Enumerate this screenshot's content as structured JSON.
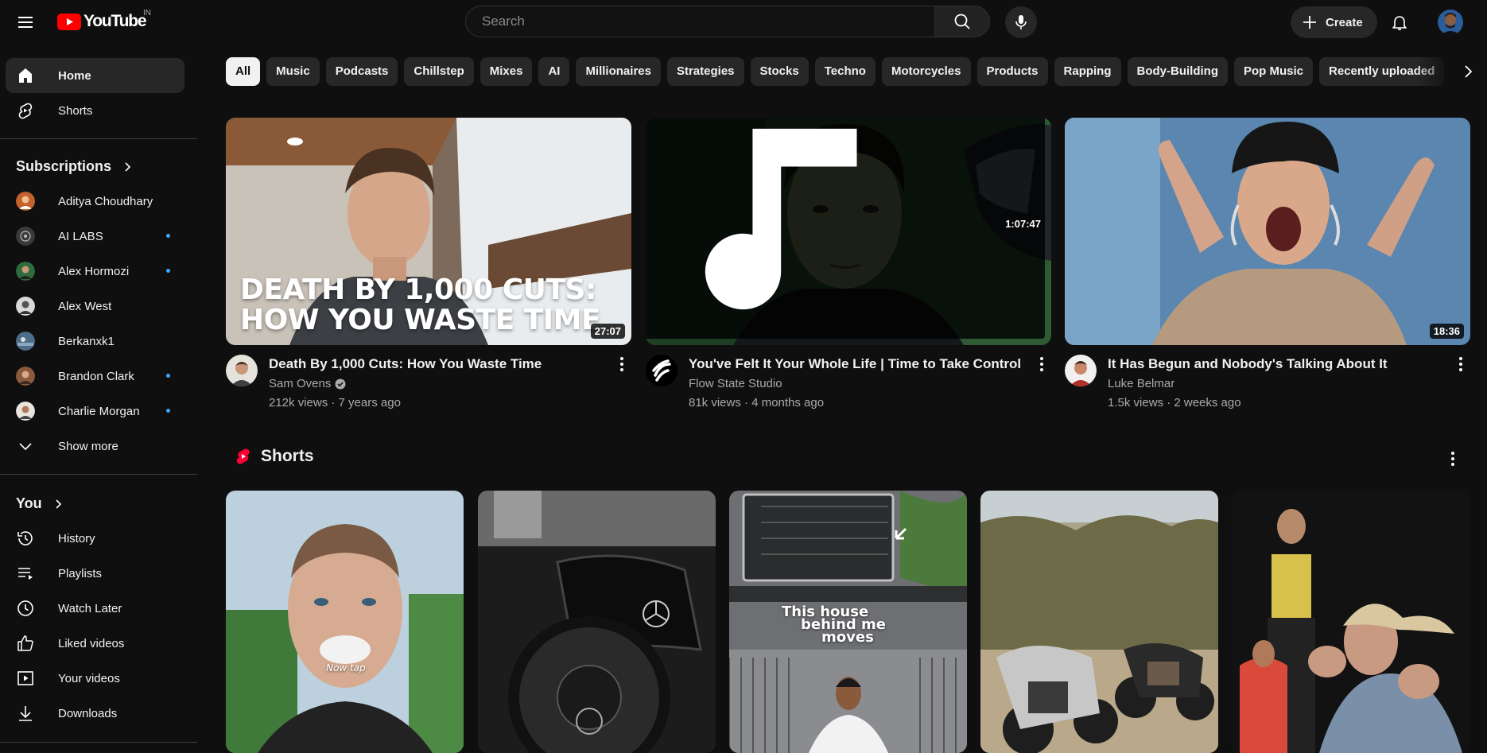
{
  "masthead": {
    "logo_text": "YouTube",
    "country_code": "IN",
    "search_placeholder": "Search",
    "create_label": "Create"
  },
  "sidebar": {
    "main": [
      {
        "label": "Home",
        "icon": "home-icon",
        "active": true
      },
      {
        "label": "Shorts",
        "icon": "shorts-icon"
      }
    ],
    "subscriptions_heading": "Subscriptions",
    "subscriptions": [
      {
        "label": "Aditya Choudhary",
        "live": false,
        "color": "#c4622d"
      },
      {
        "label": "AI LABS",
        "live": true,
        "color": "#3a3a3a"
      },
      {
        "label": "Alex Hormozi",
        "live": true,
        "color": "#2f6b3c"
      },
      {
        "label": "Alex West",
        "live": false,
        "color": "#d9d9d9"
      },
      {
        "label": "Berkanxk1",
        "live": false,
        "color": "#4d6d8a"
      },
      {
        "label": "Brandon Clark",
        "live": true,
        "color": "#8a5a3c"
      },
      {
        "label": "Charlie Morgan",
        "live": true,
        "color": "#e8e4de"
      }
    ],
    "show_more_label": "Show more",
    "you_heading": "You",
    "you_items": [
      {
        "label": "History",
        "icon": "history-icon"
      },
      {
        "label": "Playlists",
        "icon": "playlists-icon"
      },
      {
        "label": "Watch Later",
        "icon": "clock-icon"
      },
      {
        "label": "Liked videos",
        "icon": "thumbs-up-icon"
      },
      {
        "label": "Your videos",
        "icon": "your-videos-icon"
      },
      {
        "label": "Downloads",
        "icon": "download-icon"
      }
    ]
  },
  "chips": [
    "All",
    "Music",
    "Podcasts",
    "Chillstep",
    "Mixes",
    "AI",
    "Millionaires",
    "Strategies",
    "Stocks",
    "Techno",
    "Motorcycles",
    "Products",
    "Rapping",
    "Body-Building",
    "Pop Music",
    "Recently uploaded"
  ],
  "videos": [
    {
      "title": "Death By 1,000 Cuts: How You Waste Time",
      "channel": "Sam Ovens",
      "verified": true,
      "stats": "212k views · 7 years ago",
      "duration": "27:07",
      "overlay_line1": "DEATH BY 1,000 CUTS:",
      "overlay_line2": "HOW YOU WASTE TIME"
    },
    {
      "title": "You've Felt It Your Whole Life | Time to Take Control",
      "channel": "Flow State Studio",
      "verified": false,
      "stats": "81k views · 4 months ago",
      "duration": "1:07:47",
      "music": true
    },
    {
      "title": "It Has Begun and Nobody's Talking About It",
      "channel": "Luke Belmar",
      "verified": false,
      "stats": "1.5k views · 2 weeks ago",
      "duration": "18:36"
    }
  ],
  "shorts": {
    "heading": "Shorts",
    "items": [
      {
        "caption": "Now tap"
      },
      {
        "caption": ""
      },
      {
        "caption_line1": "This house",
        "caption_line2": "behind me",
        "caption_line3": "moves"
      },
      {
        "caption": ""
      },
      {
        "caption": ""
      }
    ]
  },
  "colors": {
    "background": "#0f0f0f",
    "accent_red": "#ff0000",
    "chip_bg": "#272727",
    "live_dot": "#3ea6ff"
  }
}
